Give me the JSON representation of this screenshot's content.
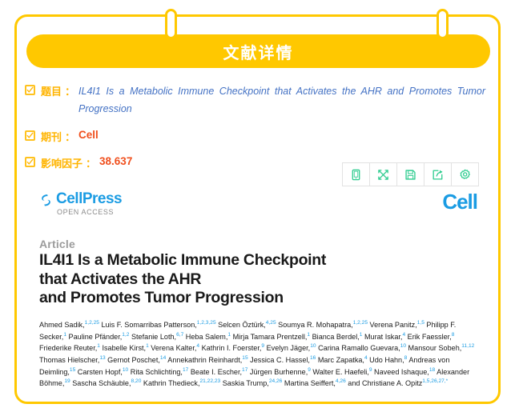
{
  "card": {
    "banner_title": "文献详情",
    "accent_color": "#FFC800",
    "clip_left_name": "binder-clip-left",
    "clip_right_name": "binder-clip-right"
  },
  "meta": {
    "rows": [
      {
        "label": "题目",
        "separator": "：",
        "value": "IL4I1 Is a Metabolic Immune Checkpoint that Activates the AHR and Promotes Tumor Progression",
        "value_style": "title"
      },
      {
        "label": "期刊",
        "separator": "：",
        "value": "Cell",
        "value_style": "strong"
      },
      {
        "label": "影响因子",
        "separator": "：",
        "value": "38.637",
        "value_style": "strong"
      }
    ],
    "label_color": "#FFB400",
    "title_color": "#4472C4",
    "value_color": "#F0501E"
  },
  "toolbar": {
    "color": "#2ECC8F",
    "buttons": [
      {
        "icon": "mobile-icon",
        "label": "Mobile view"
      },
      {
        "icon": "expand-icon",
        "label": "Fullscreen"
      },
      {
        "icon": "save-icon",
        "label": "Save"
      },
      {
        "icon": "share-icon",
        "label": "Share"
      },
      {
        "icon": "settings-icon",
        "label": "Settings"
      }
    ]
  },
  "paper": {
    "publisher": {
      "name": "CellPress",
      "tagline": "OPEN ACCESS",
      "color": "#1B9CE3"
    },
    "journal_logo": "Cell",
    "kicker": "Article",
    "title_lines": [
      "IL4I1 Is a Metabolic Immune Checkpoint",
      "that Activates the AHR",
      "and Promotes Tumor Progression"
    ],
    "authors_html": "Ahmed Sadik,<sup>1,2,25</sup> Luis F. Somarribas Patterson,<sup>1,2,3,25</sup> Selcen Öztürk,<sup>4,25</sup> Soumya R. Mohapatra,<sup>1,2,25</sup> Verena Panitz,<sup>1,5</sup> Philipp F. Secker,<sup>1</sup> Pauline Pfänder,<sup>1,2</sup> Stefanie Loth,<sup>6,7</sup> Heba Salem,<sup>1</sup> Mirja Tamara Prentzell,<sup>1</sup> Bianca Berdel,<sup>1</sup> Murat Iskar,<sup>4</sup> Erik Faessler,<sup>8</sup> Friederike Reuter,<sup>1</sup> Isabelle Kirst,<sup>1</sup> Verena Kalter,<sup>4</sup> Kathrin I. Foerster,<sup>9</sup> Evelyn Jäger,<sup>10</sup> Carina Ramallo Guevara,<sup>10</sup> Mansour Sobeh,<sup>11,12</sup> Thomas Hielscher,<sup>13</sup> Gernot Poschet,<sup>14</sup> Annekathrin Reinhardt,<sup>15</sup> Jessica C. Hassel,<sup>16</sup> Marc Zapatka,<sup>4</sup> Udo Hahn,<sup>8</sup> Andreas von Deimling,<sup>15</sup> Carsten Hopf,<sup>10</sup> Rita Schlichting,<sup>17</sup> Beate I. Escher,<sup>17</sup> Jürgen Burhenne,<sup>9</sup> Walter E. Haefeli,<sup>9</sup> Naveed Ishaque,<sup>18</sup> Alexander Böhme,<sup>19</sup> Sascha Schäuble,<sup>8,20</sup> Kathrin Thedieck,<sup>21,22,23</sup> Saskia Trump,<sup>24,26</sup> Martina Seiffert,<sup>4,26</sup> and Christiane A. Opitz<sup>1,5,26,27,*</sup>"
  }
}
